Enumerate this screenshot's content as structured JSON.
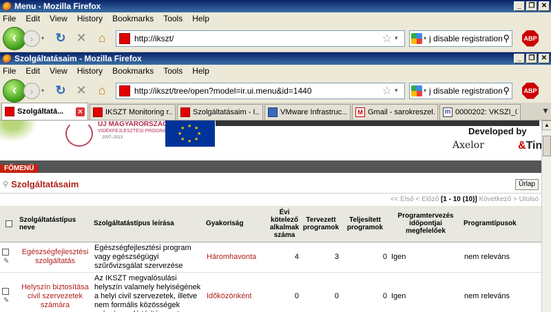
{
  "window1": {
    "title": "Menu - Mozilla Firefox",
    "url": "http://ikszt/"
  },
  "window2": {
    "title": "Szolgáltatásaim - Mozilla Firefox",
    "url": "http://ikszt/tree/open?model=ir.ui.menu&id=1440"
  },
  "menu": [
    "File",
    "Edit",
    "View",
    "History",
    "Bookmarks",
    "Tools",
    "Help"
  ],
  "window_buttons": [
    "_",
    "❐",
    "✕"
  ],
  "search_text": "j disable registration",
  "abp_label": "ABP",
  "tabs": [
    {
      "label": "Szolgáltatá...",
      "active": true
    },
    {
      "label": "IKSZT Monitoring r..."
    },
    {
      "label": "Szolgáltatásaim - I..."
    },
    {
      "label": "VMware Infrastruc..."
    },
    {
      "label": "Gmail - sarokreszel..."
    },
    {
      "label": "0000202: VKSZI_0..."
    }
  ],
  "banner": {
    "program_title": "ÚJ MAGYARORSZÁG",
    "program_sub": "VIDÉKFEJLESZTÉSI PROGRAM",
    "program_years": "2007–2013",
    "developed_by": "Developed by",
    "axelor": "Axelor",
    "amp": "&",
    "tin": "Tin"
  },
  "main_menu_label": "FŐMENÜ",
  "page_title": "Szolgáltatásaim",
  "form_button": "Űrlap",
  "pager": {
    "first": "<< Első",
    "prev": "< Előző",
    "range": "[1 - 10 (10)]",
    "next": "Következő >",
    "last": "Utolsó"
  },
  "table": {
    "headers": [
      "Szolgáltatástípus neve",
      "Szolgáltatástípus leírása",
      "Gyakoriság",
      "Évi kötelező alkalmak száma",
      "Tervezett programok",
      "Teljesített programok",
      "Programtervezés időpontjai megfelelőek",
      "Programtípusok"
    ],
    "rows": [
      {
        "name": "Egészségfejlesztési szolgáltatás",
        "description": "Egészségfejlesztési program vagy egészségügyi szűrővizsgálat szervezése",
        "frequency": "Háromhavonta",
        "required": "4",
        "planned": "3",
        "completed": "0",
        "ok": "Igen",
        "types": "nem releváns"
      },
      {
        "name": "Helyszín biztosítása civil szervezetek számára",
        "description": "Az IKSZT megvalósulási helyszín valamely helyiségének a helyi civil szervezetek, illetve nem formális közösségek számára való térítésmentes",
        "frequency": "Időközönként",
        "required": "0",
        "planned": "0",
        "completed": "0",
        "ok": "Igen",
        "types": "nem releváns"
      }
    ]
  }
}
